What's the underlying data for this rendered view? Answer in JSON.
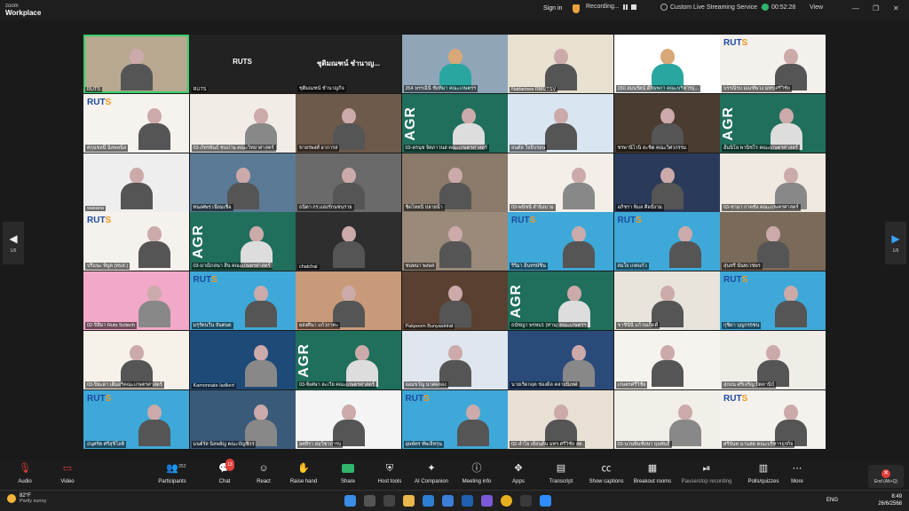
{
  "app": {
    "logo_top": "zoom",
    "logo_bottom": "Workplace"
  },
  "topbar": {
    "signin": "Sign in",
    "recording": "Recording...",
    "live": "Custom Live Streaming Service",
    "timer": "00:52:28",
    "view": "View"
  },
  "pager": {
    "left": "1/6",
    "right": "1/6"
  },
  "tiles": [
    {
      "name": "RUTS",
      "speaking": true,
      "bg": "#b8a890",
      "kind": "person"
    },
    {
      "name": "RUTS",
      "big": "RUTS",
      "bg": "#222222",
      "kind": "label"
    },
    {
      "name": "ชุติมณฑน์ ชำนาญกิจ",
      "big": "ชุติมณฑน์ ชำนาญ...",
      "bg": "#222222",
      "kind": "label"
    },
    {
      "name": "354 พรรณีนี่ ชัยทิมา คณะเกษตรฯ",
      "bg": "#8fa5b8",
      "kind": "avatar"
    },
    {
      "name": "Nattarinee  RMUTSV",
      "bg": "#e8e0d0",
      "kind": "person"
    },
    {
      "name": "150 สมนรัตน์ ดีพิมพกา คณะบริหารธุ...",
      "bg": "#ffffff",
      "kind": "avatar"
    },
    {
      "name": "บรรณิรบ มณฑ์พวง มทร.ศรีวิชัย",
      "bg": "#f4f0ec",
      "kind": "ruts"
    },
    {
      "name": "ศกุนชลนิ์ นิลพลนิล",
      "bg": "#f6f2ee",
      "kind": "ruts"
    },
    {
      "name": "03-ภัทรพันธ์ ชนปาน คณะวิทยาศาสตร์",
      "bg": "#f1ede6",
      "kind": "slide"
    },
    {
      "name": "ขายรพงศ์ อาการส",
      "bg": "#6e5a4a",
      "kind": "person"
    },
    {
      "name": "03-ดรนุช จิตภาวนส คณะเกษตรศาสตร์",
      "bg": "#1f6f5c",
      "kind": "agr"
    },
    {
      "name": "ยนตัล ใจธิบรอน",
      "bg": "#d9e6f2",
      "kind": "person"
    },
    {
      "name": "ชรพานิไวนิ สะชิต คณะวิศวกรรม",
      "bg": "#4a3c30",
      "kind": "person"
    },
    {
      "name": "อั้นนิโล พานิชโร คณะเกษตรศาสตร์",
      "bg": "#1f6f5c",
      "kind": "agr"
    },
    {
      "name": "wasana",
      "bg": "#eeeeee",
      "kind": "person"
    },
    {
      "name": "ทนงศพร เนื่ยมเชื่อ",
      "bg": "#5a7a96",
      "kind": "person"
    },
    {
      "name": "ธนิตา กร.แสงรักนชนราย",
      "bg": "#6a6a6a",
      "kind": "person"
    },
    {
      "name": "ชิดไทยนี ปลายน้ำ",
      "bg": "#8a7a6a",
      "kind": "person"
    },
    {
      "name": "03-พนิชนี สำนิงมาม",
      "bg": "#f3efe8",
      "kind": "slide"
    },
    {
      "name": "อภิชรา พิมล ศิลป์งาม",
      "bg": "#2a3a5a",
      "kind": "person"
    },
    {
      "name": "03-ชามา กาดชัง คณะเกษตรศาสตร์",
      "bg": "#efe9df",
      "kind": "slide"
    },
    {
      "name": "ปรีแนะ พิบูต (ทบส.)",
      "bg": "#f5f1ec",
      "kind": "ruts"
    },
    {
      "name": "03-มาณิกลนา สิน คณะเกษตรศาสตร์",
      "bg": "#1f6f5c",
      "kind": "agr"
    },
    {
      "name": "chatchai",
      "bg": "#2e2e2e",
      "kind": "person"
    },
    {
      "name": "ชนพนา พงษส",
      "bg": "#9a8a7a",
      "kind": "person"
    },
    {
      "name": "ริริมา อินทรษ์ชิน",
      "bg": "#3ea8d8",
      "kind": "ruts"
    },
    {
      "name": "สมใจ เกตแก้ว",
      "bg": "#3ea8d8",
      "kind": "ruts"
    },
    {
      "name": "สุนทรี นันทเวชพร",
      "bg": "#7a6a5a",
      "kind": "person"
    },
    {
      "name": "02-ปิสิมา Ruts Scitech",
      "bg": "#f2a8c8",
      "kind": "slide"
    },
    {
      "name": "มรุรัตนวีน จันตนด",
      "bg": "#3ea8d8",
      "kind": "ruts"
    },
    {
      "name": "ผสงศินา แก้วกาตะ",
      "bg": "#c89a7a",
      "kind": "person"
    },
    {
      "name": "Pakpoom Bunyasirirat",
      "bg": "#5a4030",
      "kind": "person"
    },
    {
      "name": "ธนัชญา  พรหม1 (ท่าน) คณะเกษตรฯ",
      "bg": "#1f6f5c",
      "kind": "agr"
    },
    {
      "name": "ขาชินีนี แก้วนเกิดดี",
      "bg": "#e8e4dc",
      "kind": "person"
    },
    {
      "name": "กุชิดา บุญกร5ชน",
      "bg": "#3ea8d8",
      "kind": "ruts"
    },
    {
      "name": "03-ปิยะดา เต็มอริคณะเกษตรศาสตร์",
      "bg": "#f6f2ea",
      "kind": "person"
    },
    {
      "name": "Kamonnate Iadkert",
      "bg": "#1e4a78",
      "kind": "slide"
    },
    {
      "name": "03-พิเศษา ละเวีย คณะเกษตรศาสตร์",
      "bg": "#1f6f5c",
      "kind": "agr"
    },
    {
      "name": "จอมขวัญ นาคผลอง",
      "bg": "#dfe6ee",
      "kind": "person"
    },
    {
      "name": "นายเริ่ดกฤต ช่องดิล คลายนิเทศ",
      "bg": "#2a4a7a",
      "kind": "slide"
    },
    {
      "name": "เกษตรศรีวิชัย",
      "bg": "#f6f3ef",
      "kind": "person"
    },
    {
      "name": "สุกบน ศรีเจริญ ปัตตานีบ์",
      "bg": "#f0ece6",
      "kind": "person"
    },
    {
      "name": "ธนุศรัต ศรีสุขิโลติ",
      "bg": "#3ea8d8",
      "kind": "ruts"
    },
    {
      "name": "มนต์รัส นิลพยัญ คณะบัญชีกร",
      "bg": "#3a5a7a",
      "kind": "slide"
    },
    {
      "name": "ยศสิรา สมวิชาการบ",
      "bg": "#f4f4f4",
      "kind": "person"
    },
    {
      "name": "อุษพ์ทร ทัพเจ็ทรุน",
      "bg": "#3ea8d8",
      "kind": "ruts"
    },
    {
      "name": "02-ลำไย เยือนดิน มทร.ศรีวิชัย สต.",
      "bg": "#e8e0d4",
      "kind": "person"
    },
    {
      "name": "03-นวนพินฑิงษา บุษพันธิ์",
      "bg": "#f2eee8",
      "kind": "slide"
    },
    {
      "name": "ศรีจันท นานสด คณะบริหารธุรกิจ",
      "bg": "#f5f2ee",
      "kind": "ruts"
    }
  ],
  "toolbar": {
    "audio": "Audio",
    "video": "Video",
    "participants": "Participants",
    "participants_count": "252",
    "chat": "Chat",
    "chat_badge": "13",
    "react": "React",
    "raise_hand": "Raise hand",
    "share": "Share",
    "host_tools": "Host tools",
    "ai_companion": "AI Companion",
    "meeting_info": "Meeting info",
    "apps": "Apps",
    "transcript": "Transcript",
    "show_captions": "Show captions",
    "breakout_rooms": "Breakout rooms",
    "pause_recording": "Pause/stop recording",
    "polls": "Polls/quizzes",
    "more": "More",
    "end": "End (Alt+Q)"
  },
  "taskbar": {
    "temp": "82°F",
    "weather": "Partly sunny",
    "lang": "ENG",
    "time": "8:49",
    "date": "26/6/2568"
  },
  "colors": {
    "accent_green": "#36d06b",
    "end_red": "#e0403a",
    "ruts_blue": "#1c4aa0"
  }
}
